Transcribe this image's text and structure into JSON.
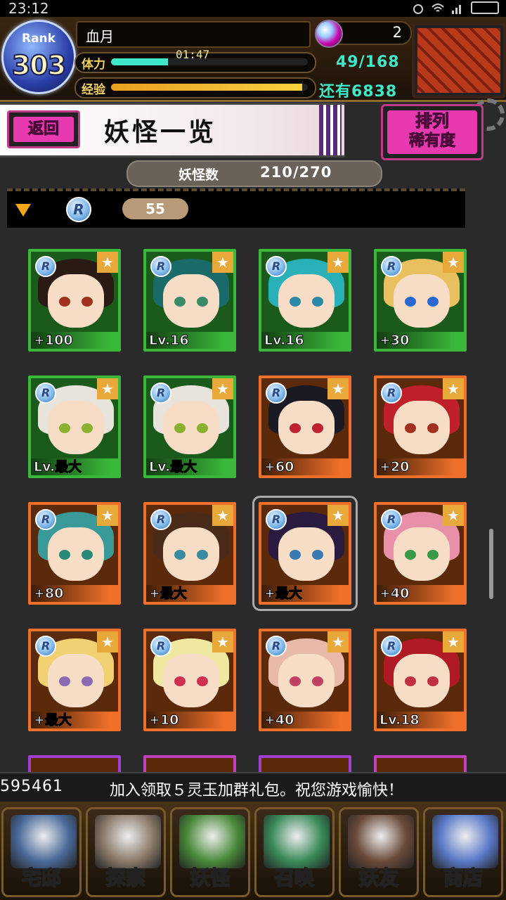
{
  "status_bar": {
    "time": "23:12"
  },
  "player": {
    "rank_label": "Rank",
    "rank": "303",
    "name": "血月",
    "gems": "2",
    "stamina_label": "体力",
    "stamina_timer": "01:47",
    "stamina_value": "49/168",
    "stamina_fraction": 0.29,
    "exp_label": "经验",
    "exp_remaining": "还有6838",
    "exp_fraction": 0.97
  },
  "titlebar": {
    "back_label": "返回",
    "title": "妖怪一览"
  },
  "sort_button": {
    "line1": "排列",
    "line2": "稀有度"
  },
  "yokai_count": {
    "label": "妖怪数",
    "value": "210/270"
  },
  "group": {
    "rarity": "R",
    "count": "55"
  },
  "cards": [
    {
      "level": "+100",
      "frame": "green",
      "hair": "#2a1a14",
      "eye": "#a03020"
    },
    {
      "level": "Lv.16",
      "frame": "green",
      "hair": "#1a6a6a",
      "eye": "#3a8a6a"
    },
    {
      "level": "Lv.16",
      "frame": "green",
      "hair": "#2ab0b8",
      "eye": "#2a8aa8"
    },
    {
      "level": "+30",
      "frame": "green",
      "hair": "#e8c060",
      "eye": "#2a6ad0"
    },
    {
      "level": "Lv.最大",
      "frame": "green",
      "hair": "#e8e4dc",
      "eye": "#8ab030"
    },
    {
      "level": "Lv.最大",
      "frame": "green",
      "hair": "#e8e4dc",
      "eye": "#8ab030"
    },
    {
      "level": "+60",
      "frame": "orange",
      "hair": "#1a1a24",
      "eye": "#c02030"
    },
    {
      "level": "+20",
      "frame": "orange",
      "hair": "#c0202a",
      "eye": "#a03020"
    },
    {
      "level": "+80",
      "frame": "orange",
      "hair": "#3a9a9a",
      "eye": "#2a8a7a"
    },
    {
      "level": "+最大",
      "frame": "orange",
      "hair": "#4a2a18",
      "eye": "#3a8aa0"
    },
    {
      "level": "+最大",
      "frame": "orange",
      "hair": "#2a1a40",
      "eye": "#3a7ab0",
      "selected": true
    },
    {
      "level": "+40",
      "frame": "orange",
      "hair": "#e890a8",
      "eye": "#3a9a4a"
    },
    {
      "level": "+最大",
      "frame": "orange",
      "hair": "#f0d070",
      "eye": "#8a6ab0"
    },
    {
      "level": "+10",
      "frame": "orange",
      "hair": "#f0e8a0",
      "eye": "#d03050"
    },
    {
      "level": "+40",
      "frame": "orange",
      "hair": "#e8b8a8",
      "eye": "#c04060"
    },
    {
      "level": "Lv.18",
      "frame": "orange",
      "hair": "#b01a24",
      "eye": "#c03040"
    }
  ],
  "ticker": {
    "left": "595461",
    "message": "加入领取５灵玉加群礼包。祝您游戏愉快！"
  },
  "nav": [
    {
      "label": "宅邸",
      "icon": "house-icon",
      "color": "#4a6a9a"
    },
    {
      "label": "探索",
      "icon": "magnifier-icon",
      "color": "#8a7a6a"
    },
    {
      "label": "妖怪",
      "icon": "scroll-icon",
      "color": "#4a8a3a"
    },
    {
      "label": "召唤",
      "icon": "pentagram-icon",
      "color": "#3a8a5a"
    },
    {
      "label": "妖友",
      "icon": "friend-icon",
      "color": "#6a4a3a"
    },
    {
      "label": "商店",
      "icon": "orb-icon",
      "color": "#5a7ac8"
    }
  ],
  "colors": {
    "accent_pink": "#e83ab0",
    "stamina_teal": "#3ee8c8",
    "frame_green": "#3ab83a",
    "frame_orange": "#f0702a"
  }
}
